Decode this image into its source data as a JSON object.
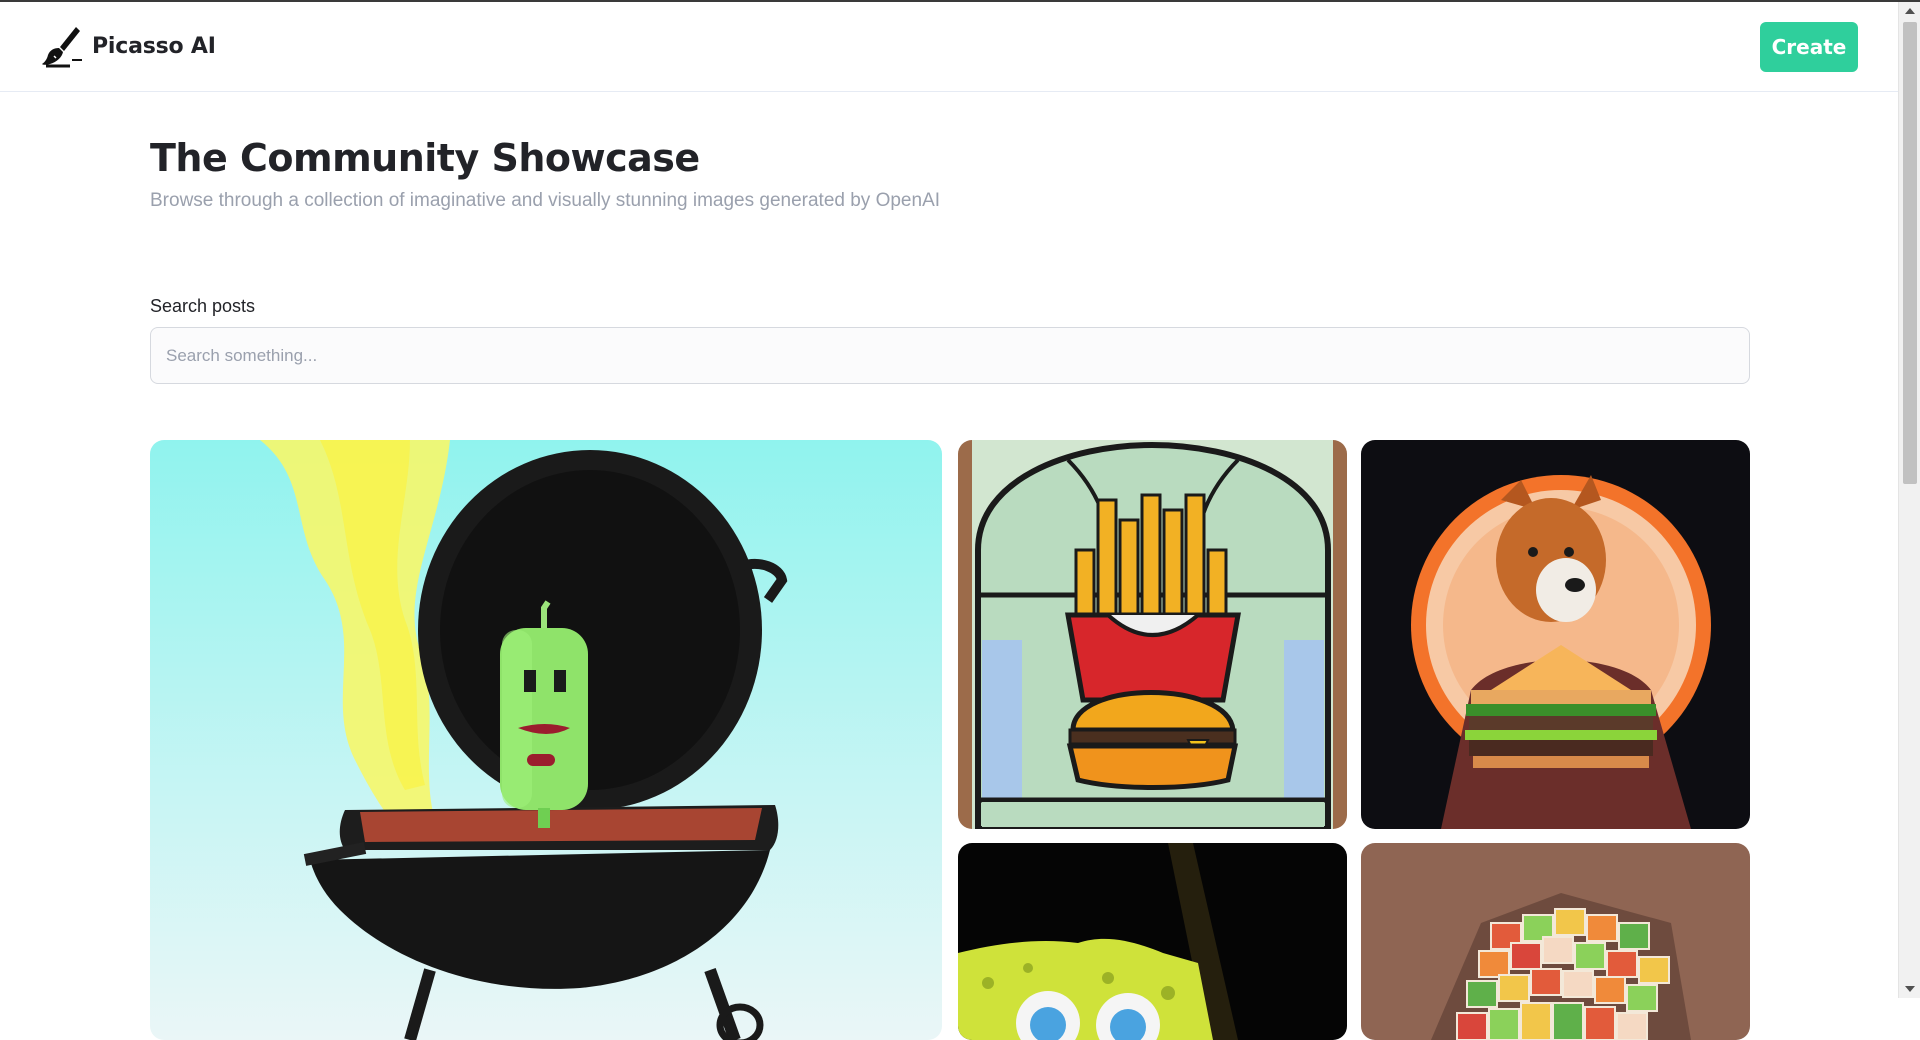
{
  "header": {
    "brand_name": "Picasso AI",
    "logo_icon": "paintbrush-icon",
    "create_label": "Create"
  },
  "hero": {
    "title": "The Community Showcase",
    "subtitle": "Browse through a collection of imaginative and visually stunning images generated by OpenAI"
  },
  "search": {
    "label": "Search posts",
    "placeholder": "Search something...",
    "value": ""
  },
  "gallery": {
    "cards": [
      {
        "subject": "green popsicle character on a charcoal grill"
      },
      {
        "subject": "stained glass fries and burger"
      },
      {
        "subject": "shiba inu with glowing burger"
      },
      {
        "subject": "yellow sponge character"
      },
      {
        "subject": "multicolor cube of sweets"
      }
    ]
  },
  "colors": {
    "accent": "#2fcf9c",
    "title": "#222328",
    "muted": "#9aa0ad"
  }
}
